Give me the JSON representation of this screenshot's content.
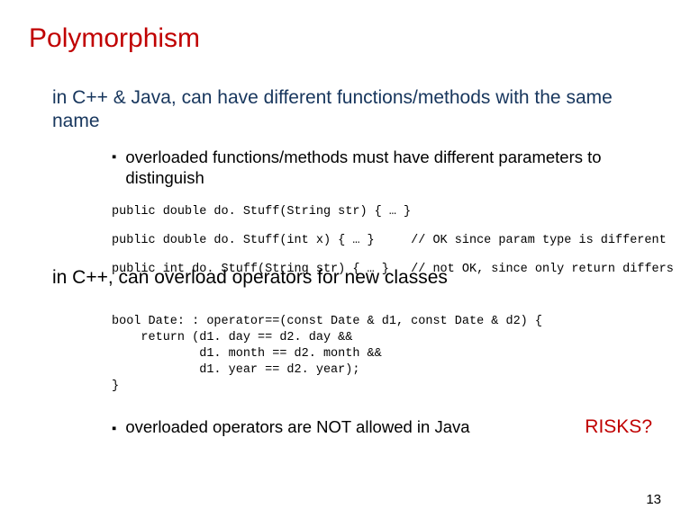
{
  "title": "Polymorphism",
  "p1": "in C++ & Java, can have different functions/methods with the same name",
  "b1": "overloaded functions/methods must have different parameters to distinguish",
  "code1": "public double do. Stuff(String str) { … }",
  "code2": "public double do. Stuff(int x) { … }     // OK since param type is different",
  "code3": "public int do. Stuff(String str) { … }   // not OK, since only return differs",
  "p2": "in C++, can overload operators for new classes",
  "code4": "bool Date: : operator==(const Date & d1, const Date & d2) {\n    return (d1. day == d2. day &&\n            d1. month == d2. month &&\n            d1. year == d2. year);\n}",
  "b2": "overloaded operators are NOT allowed in Java",
  "risks": "RISKS?",
  "pagenum": "13"
}
